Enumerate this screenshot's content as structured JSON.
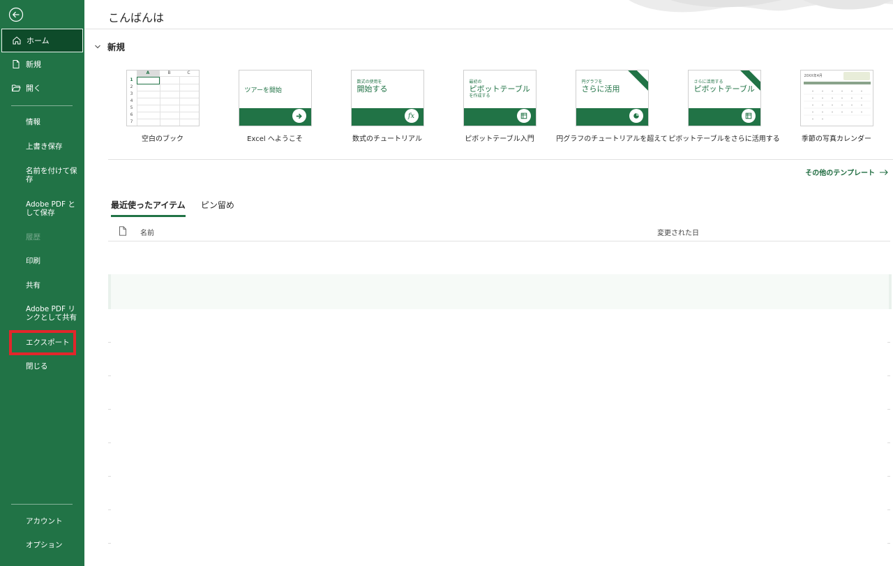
{
  "sidebar": {
    "nav": [
      {
        "label": "ホーム",
        "icon": "home-icon",
        "selected": true
      },
      {
        "label": "新規",
        "icon": "new-file-icon"
      },
      {
        "label": "開く",
        "icon": "folder-open-icon"
      }
    ],
    "items": [
      {
        "label": "情報"
      },
      {
        "label": "上書き保存"
      },
      {
        "label": "名前を付けて保存"
      },
      {
        "label": "Adobe PDF として保存"
      },
      {
        "label": "履歴",
        "disabled": true
      },
      {
        "label": "印刷"
      },
      {
        "label": "共有"
      },
      {
        "label": "Adobe PDF リンクとして共有"
      },
      {
        "label": "エクスポート",
        "highlighted": true
      },
      {
        "label": "閉じる"
      }
    ],
    "bottom": [
      {
        "label": "アカウント"
      },
      {
        "label": "オプション"
      }
    ],
    "highlight_color": "#e3262b"
  },
  "main": {
    "greeting": "こんばんは",
    "new_section": {
      "title": "新規",
      "templates": [
        {
          "label": "空白のブック",
          "kind": "blank",
          "grid_cols": [
            "A",
            "B",
            "C"
          ],
          "grid_rows": [
            "1",
            "2",
            "3",
            "4",
            "5",
            "6",
            "7"
          ]
        },
        {
          "label": "Excel へようこそ",
          "kind": "banner",
          "thumb_small": "",
          "thumb_big": "ツアーを開始",
          "icon": "arrow-right-icon"
        },
        {
          "label": "数式のチュートリアル",
          "kind": "banner",
          "thumb_small": "数式の使用を",
          "thumb_big": "開始する",
          "icon": "function-icon"
        },
        {
          "label": "ピボットテーブル入門",
          "kind": "banner",
          "thumb_small": "最初の",
          "thumb_big": "ピボットテーブル",
          "thumb_small2": "を作成する",
          "icon": "pivot-icon"
        },
        {
          "label": "円グラフのチュートリアルを超えて",
          "kind": "banner",
          "thumb_small": "円グラフを",
          "thumb_big": "さらに活用",
          "icon": "pie-chart-icon",
          "corner": true
        },
        {
          "label": "ピボットテーブルをさらに活用する",
          "kind": "banner",
          "thumb_small": "さらに活用する",
          "thumb_big": "ピボットテーブル",
          "icon": "pivot-icon",
          "corner": true
        },
        {
          "label": "季節の写真カレンダー",
          "kind": "calendar",
          "thumb_small": "20XX年4月"
        }
      ],
      "more_link": "その他のテンプレート"
    },
    "tabs": [
      {
        "label": "最近使ったアイテム",
        "active": true
      },
      {
        "label": "ピン留め"
      }
    ],
    "list": {
      "col_name": "名前",
      "col_modified": "変更された日"
    }
  },
  "colors": {
    "brand": "#217346",
    "brand_dark": "#0e4b2a"
  }
}
